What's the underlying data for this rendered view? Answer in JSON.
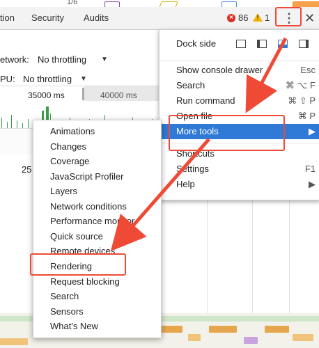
{
  "top_strip": {
    "fragment_number": "1/6"
  },
  "toolbar": {
    "tabs": [
      {
        "label": "tion"
      },
      {
        "label": "Security"
      },
      {
        "label": "Audits"
      }
    ],
    "error_count": "86",
    "warning_count": "1",
    "error_glyph": "×",
    "warning_glyph": "!",
    "menu_glyph": "⋮",
    "close_glyph": "✕"
  },
  "panel": {
    "network_label": "etwork:",
    "network_value": "No throttling",
    "cpu_label": "PU:",
    "cpu_value": "No throttling",
    "dropdown_glyph": "▼",
    "ruler_left": "35000 ms",
    "ruler_right": "40000 ms",
    "bottom_number": "25"
  },
  "main_menu": {
    "dock_side_label": "Dock side",
    "items": [
      {
        "label": "Show console drawer",
        "shortcut": "Esc"
      },
      {
        "label": "Search",
        "shortcut": "⌘ ⌥ F"
      },
      {
        "label": "Run command",
        "shortcut": "⌘ ⇧ P"
      },
      {
        "label": "Open file",
        "shortcut": "⌘ P"
      },
      {
        "label": "More tools",
        "shortcut": "▶"
      },
      {
        "label": "Shortcuts",
        "shortcut": ""
      },
      {
        "label": "Settings",
        "shortcut": "F1"
      },
      {
        "label": "Help",
        "shortcut": "▶"
      }
    ]
  },
  "more_tools_menu": {
    "items": [
      "Animations",
      "Changes",
      "Coverage",
      "JavaScript Profiler",
      "Layers",
      "Network conditions",
      "Performance monitor",
      "Quick source",
      "Remote devices",
      "Rendering",
      "Request blocking",
      "Search",
      "Sensors",
      "What's New"
    ],
    "highlighted_item": "Rendering"
  },
  "colors": {
    "accent": "#2f79d7",
    "annotation_red": "#ee4a36",
    "error_red": "#d93025",
    "warning_yellow": "#f4b400",
    "overview_green": "#3a9d4a"
  },
  "icons": [
    "error-icon",
    "warning-icon",
    "kebab-menu-icon",
    "close-icon",
    "dock-undock-icon",
    "dock-left-icon",
    "dock-bottom-icon",
    "dock-right-icon",
    "submenu-arrow-icon"
  ]
}
